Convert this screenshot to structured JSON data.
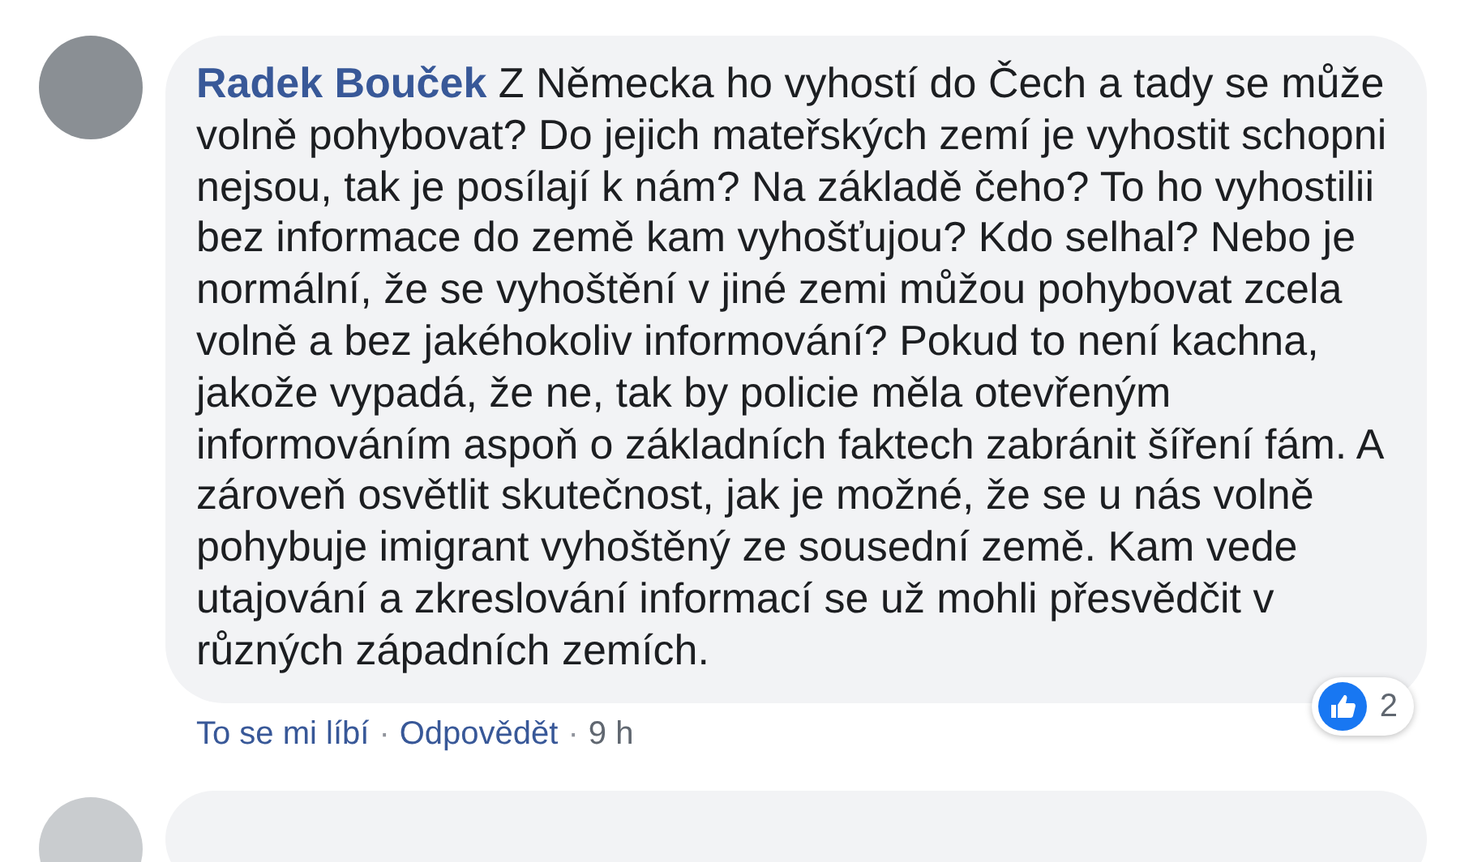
{
  "comment": {
    "author": "Radek Bouček",
    "text": "Z Německa ho vyhostí do Čech a tady se může volně pohybovat? Do jejich mateřských zemí je vyhostit schopni nejsou, tak je posílají k nám? Na základě čeho? To ho vyhostilii bez informace do země kam vyhošťujou? Kdo selhal? Nebo je normální, že se vyhoštění v jiné zemi můžou pohybovat zcela volně a bez jakéhokoliv informování? Pokud to není kachna, jakože vypadá, že ne, tak by policie měla otevřeným informováním aspoň o základních faktech zabránit šíření fám. A zároveň osvětlit skutečnost, jak je možné, že se u nás volně pohybuje imigrant vyhoštěný ze sousední země. Kam vede utajování a zkreslování informací se už mohli přesvědčit v různých západních zemích.",
    "reaction_count": "2",
    "actions": [
      {
        "kind": "link",
        "label": "To se mi líbí"
      },
      {
        "kind": "separator",
        "label": "·"
      },
      {
        "kind": "link",
        "label": "Odpovědět"
      },
      {
        "kind": "separator",
        "label": "·"
      },
      {
        "kind": "time",
        "label": "9 h"
      }
    ]
  }
}
